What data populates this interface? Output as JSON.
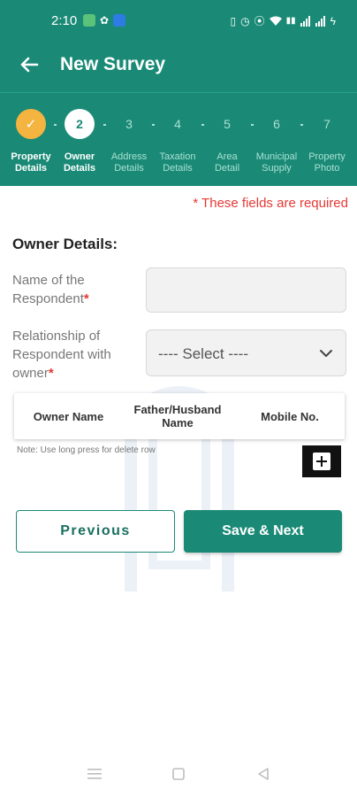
{
  "status_bar": {
    "time": "2:10",
    "icons": [
      "message-icon",
      "fan-icon",
      "bluetooth-icon",
      "vibrate-icon",
      "alarm-icon",
      "location-icon",
      "wifi-icon",
      "volte-icon",
      "signal-icon",
      "signal-icon",
      "charging-icon"
    ]
  },
  "app_bar": {
    "title": "New Survey",
    "back_icon": "arrow-left-icon"
  },
  "stepper": {
    "steps": [
      {
        "number": "✓",
        "label_line1": "Property",
        "label_line2": "Details",
        "state": "done"
      },
      {
        "number": "2",
        "label_line1": "Owner",
        "label_line2": "Details",
        "state": "active"
      },
      {
        "number": "3",
        "label_line1": "Address",
        "label_line2": "Details",
        "state": "pending"
      },
      {
        "number": "4",
        "label_line1": "Taxation",
        "label_line2": "Details",
        "state": "pending"
      },
      {
        "number": "5",
        "label_line1": "Area",
        "label_line2": "Detail",
        "state": "pending"
      },
      {
        "number": "6",
        "label_line1": "Municipal",
        "label_line2": "Supply",
        "state": "pending"
      },
      {
        "number": "7",
        "label_line1": "Property",
        "label_line2": "Photo",
        "state": "pending"
      }
    ]
  },
  "form": {
    "required_note": "* These fields are required",
    "section_title": "Owner Details:",
    "respondent_label": "Name of the Respondent",
    "respondent_value": "",
    "relationship_label": "Relationship of Respondent with owner",
    "relationship_selected": "---- Select ----",
    "required_mark": "*"
  },
  "owner_table": {
    "columns": [
      "Owner Name",
      "Father/Husband Name",
      "Mobile No."
    ],
    "rows": [],
    "note": "Note: Use long press for delete row"
  },
  "actions": {
    "previous_label": "Previous",
    "save_next_label": "Save & Next"
  },
  "colors": {
    "primary": "#1a8a76",
    "done_step": "#f4b43f",
    "required": "#e53935"
  }
}
